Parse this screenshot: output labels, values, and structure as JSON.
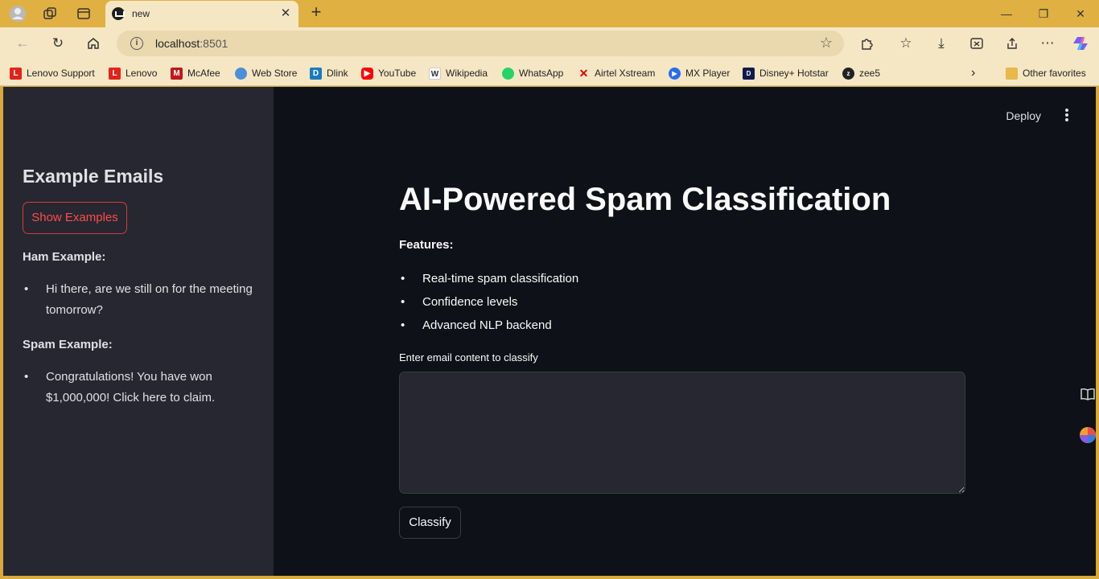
{
  "browser": {
    "tab_title": "new",
    "address": "localhost",
    "address_port": ":8501",
    "bookmarks": [
      {
        "label": "Lenovo Support",
        "icon": "lenovo-icon",
        "color": "#e2231a"
      },
      {
        "label": "Lenovo",
        "icon": "lenovo-icon",
        "color": "#e2231a"
      },
      {
        "label": "McAfee",
        "icon": "mcafee-icon",
        "color": "#c01818"
      },
      {
        "label": "Web Store",
        "icon": "webstore-icon",
        "color": "#4a90d9"
      },
      {
        "label": "Dlink",
        "icon": "dlink-icon",
        "color": "#1a7bbf"
      },
      {
        "label": "YouTube",
        "icon": "youtube-icon",
        "color": "#ff0000"
      },
      {
        "label": "Wikipedia",
        "icon": "wikipedia-icon",
        "color": "#666666"
      },
      {
        "label": "WhatsApp",
        "icon": "whatsapp-icon",
        "color": "#25d366"
      },
      {
        "label": "Airtel Xstream",
        "icon": "airtel-icon",
        "color": "#e40000"
      },
      {
        "label": "MX Player",
        "icon": "mxplayer-icon",
        "color": "#2a6cf0"
      },
      {
        "label": "Disney+ Hotstar",
        "icon": "hotstar-icon",
        "color": "#0f1b4a"
      },
      {
        "label": "zee5",
        "icon": "zee5-icon",
        "color": "#222222"
      }
    ],
    "other_favorites": "Other favorites"
  },
  "sidebar": {
    "title": "Example Emails",
    "show_button": "Show Examples",
    "ham_label": "Ham Example:",
    "ham_text": "Hi there, are we still on for the meeting tomorrow?",
    "spam_label": "Spam Example:",
    "spam_text": "Congratulations! You have won $1,000,000! Click here to claim."
  },
  "main": {
    "deploy": "Deploy",
    "title": "AI-Powered Spam Classification",
    "features_label": "Features:",
    "features": [
      "Real-time spam classification",
      "Confidence levels",
      "Advanced NLP backend"
    ],
    "input_label": "Enter email content to classify",
    "input_value": "",
    "classify_button": "Classify"
  },
  "colors": {
    "accent": "#ff4b4b",
    "app_bg": "#0e1117",
    "sidebar_bg": "#262730",
    "browser_frame": "#e0b043"
  }
}
